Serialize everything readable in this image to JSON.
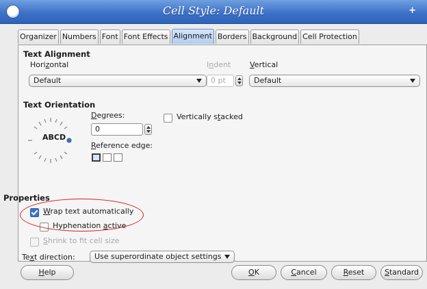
{
  "window": {
    "title": "Cell Style: Default"
  },
  "tabs": [
    {
      "label": "Organizer"
    },
    {
      "label": "Numbers"
    },
    {
      "label": "Font"
    },
    {
      "label": "Font Effects"
    },
    {
      "label": "Alignment",
      "active": true
    },
    {
      "label": "Borders"
    },
    {
      "label": "Background"
    },
    {
      "label": "Cell Protection"
    }
  ],
  "text_alignment": {
    "heading": "Text Alignment",
    "horizontal_label": "Horizontal",
    "horizontal_value": "Default",
    "indent_label": "Indent",
    "indent_value": "0 pt",
    "vertical_label": "Vertical",
    "vertical_value": "Default"
  },
  "text_orientation": {
    "heading": "Text Orientation",
    "dial_text": "ABCD",
    "degrees_label": "Degrees:",
    "degrees_value": "0",
    "reference_edge_label": "Reference edge:",
    "vertically_stacked_label": "Vertically stacked",
    "vertically_stacked_checked": false
  },
  "properties": {
    "heading": "Properties",
    "wrap_text_label": "Wrap text automatically",
    "wrap_text_checked": true,
    "hyphenation_label": "Hyphenation active",
    "hyphenation_checked": false,
    "shrink_label": "Shrink to fit cell size",
    "shrink_checked": false,
    "text_direction_label": "Text direction:",
    "text_direction_value": "Use superordinate object settings"
  },
  "buttons": {
    "help": "Help",
    "ok": "OK",
    "cancel": "Cancel",
    "reset": "Reset",
    "standard": "Standard"
  },
  "colors": {
    "titlebar": "#3d72c8",
    "active_tab": "#b3cdee",
    "annotation": "#d21d1d",
    "checkbox_checked": "#3b73c7"
  }
}
